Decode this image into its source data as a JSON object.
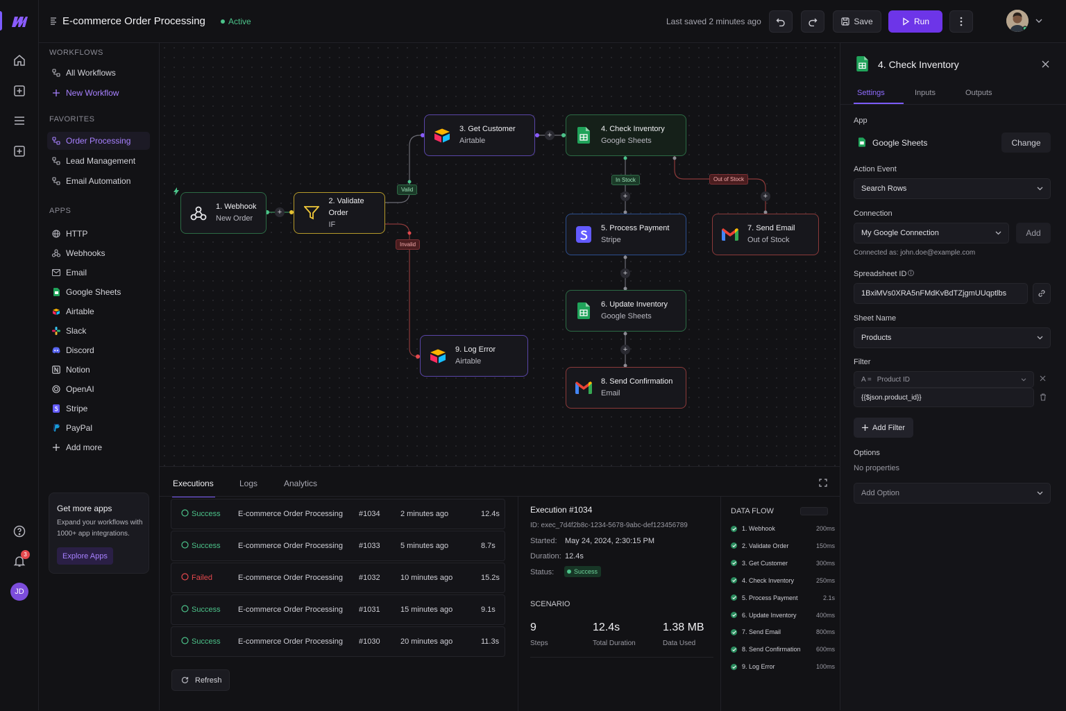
{
  "app": {
    "logo_icon": "m-logo-icon",
    "accent": "#7c5cff"
  },
  "header": {
    "title": "E-commerce Order Processing",
    "status": "Active",
    "last_saved": "Last saved 2 minutes ago",
    "save_label": "Save",
    "run_label": "Run"
  },
  "rail": {
    "avatar_initials": "JD",
    "notification_count": "3"
  },
  "sidebar": {
    "workflows_heading": "WORKFLOWS",
    "workflows": [
      {
        "label": "All Workflows"
      },
      {
        "label": "New Workflow"
      }
    ],
    "favorites_heading": "FAVORITES",
    "favorites": [
      {
        "label": "Order Processing"
      },
      {
        "label": "Lead Management"
      },
      {
        "label": "Email Automation"
      }
    ],
    "apps_heading": "APPS",
    "apps": [
      {
        "label": "HTTP"
      },
      {
        "label": "Webhooks"
      },
      {
        "label": "Email"
      },
      {
        "label": "Google Sheets"
      },
      {
        "label": "Airtable"
      },
      {
        "label": "Slack"
      },
      {
        "label": "Discord"
      },
      {
        "label": "Notion"
      },
      {
        "label": "OpenAI"
      },
      {
        "label": "Stripe"
      },
      {
        "label": "PayPal"
      },
      {
        "label": "Add more"
      }
    ],
    "promo": {
      "title": "Get more apps",
      "body": "Expand your workflows with 1000+ app integrations.",
      "button": "Explore Apps"
    }
  },
  "canvas": {
    "nodes": [
      {
        "title": "1. Webhook",
        "subtitle": "New Order"
      },
      {
        "title": "2. Validate Order",
        "subtitle": "IF"
      },
      {
        "title": "3. Get Customer",
        "subtitle": "Airtable"
      },
      {
        "title": "4. Check Inventory",
        "subtitle": "Google Sheets"
      },
      {
        "title": "5. Process Payment",
        "subtitle": "Stripe"
      },
      {
        "title": "6. Update Inventory",
        "subtitle": "Google Sheets"
      },
      {
        "title": "7. Send Email",
        "subtitle": "Out of Stock"
      },
      {
        "title": "8. Send Confirmation",
        "subtitle": "Email"
      },
      {
        "title": "9. Log Error",
        "subtitle": "Airtable"
      }
    ],
    "labels": {
      "valid": "Valid",
      "invalid": "Invalid",
      "in_stock": "In Stock",
      "out_of_stock": "Out of Stock"
    }
  },
  "bottom": {
    "tabs": [
      {
        "label": "Executions"
      },
      {
        "label": "Logs"
      },
      {
        "label": "Analytics"
      }
    ],
    "executions": [
      {
        "status": "Success",
        "name": "E-commerce Order Processing",
        "id": "#1034",
        "time": "2 minutes ago",
        "duration": "12.4s"
      },
      {
        "status": "Success",
        "name": "E-commerce Order Processing",
        "id": "#1033",
        "time": "5 minutes ago",
        "duration": "8.7s"
      },
      {
        "status": "Failed",
        "name": "E-commerce Order Processing",
        "id": "#1032",
        "time": "10 minutes ago",
        "duration": "15.2s"
      },
      {
        "status": "Success",
        "name": "E-commerce Order Processing",
        "id": "#1031",
        "time": "15 minutes ago",
        "duration": "9.1s"
      },
      {
        "status": "Success",
        "name": "E-commerce Order Processing",
        "id": "#1030",
        "time": "20 minutes ago",
        "duration": "11.3s"
      }
    ],
    "refresh_label": "Refresh",
    "detail": {
      "title": "Execution #1034",
      "id": "ID: exec_7d4f2b8c-1234-5678-9abc-def123456789",
      "started_label": "Started:",
      "started": "May 24, 2024, 2:30:15 PM",
      "duration_label": "Duration:",
      "duration": "12.4s",
      "status_label": "Status:",
      "status": "Success",
      "scenario_heading": "SCENARIO",
      "stats": [
        {
          "value": "9",
          "label": "Steps"
        },
        {
          "value": "12.4s",
          "label": "Total Duration"
        },
        {
          "value": "1.38 MB",
          "label": "Data Used"
        }
      ]
    },
    "dataflow": {
      "heading": "DATA FLOW",
      "steps": [
        {
          "name": "1. Webhook",
          "ms": "200ms"
        },
        {
          "name": "2. Validate Order",
          "ms": "150ms"
        },
        {
          "name": "3. Get Customer",
          "ms": "300ms"
        },
        {
          "name": "4. Check Inventory",
          "ms": "250ms"
        },
        {
          "name": "5. Process Payment",
          "ms": "2.1s"
        },
        {
          "name": "6. Update Inventory",
          "ms": "400ms"
        },
        {
          "name": "7. Send Email",
          "ms": "800ms"
        },
        {
          "name": "8. Send Confirmation",
          "ms": "600ms"
        },
        {
          "name": "9. Log Error",
          "ms": "100ms"
        }
      ]
    }
  },
  "panel": {
    "title": "4. Check Inventory",
    "tabs": [
      {
        "label": "Settings"
      },
      {
        "label": "Inputs"
      },
      {
        "label": "Outputs"
      }
    ],
    "app_label": "App",
    "app_value": "Google Sheets",
    "change_label": "Change",
    "action_label": "Action Event",
    "action_value": "Search Rows",
    "connection_label": "Connection",
    "connection_value": "My Google Connection",
    "add_label": "Add",
    "connected_as": "Connected as: john.doe@example.com",
    "spreadsheet_label": "Spreadsheet ID",
    "spreadsheet_value": "1BxiMVs0XRA5nFMdKvBdTZjgmUUqptlbs",
    "sheet_label": "Sheet Name",
    "sheet_value": "Products",
    "filter_label": "Filter",
    "filter_op": "A =",
    "filter_field": "Product ID",
    "filter_value": "{{$json.product_id}}",
    "add_filter_label": "Add Filter",
    "options_label": "Options",
    "options_empty": "No properties",
    "add_option_label": "Add Option"
  }
}
